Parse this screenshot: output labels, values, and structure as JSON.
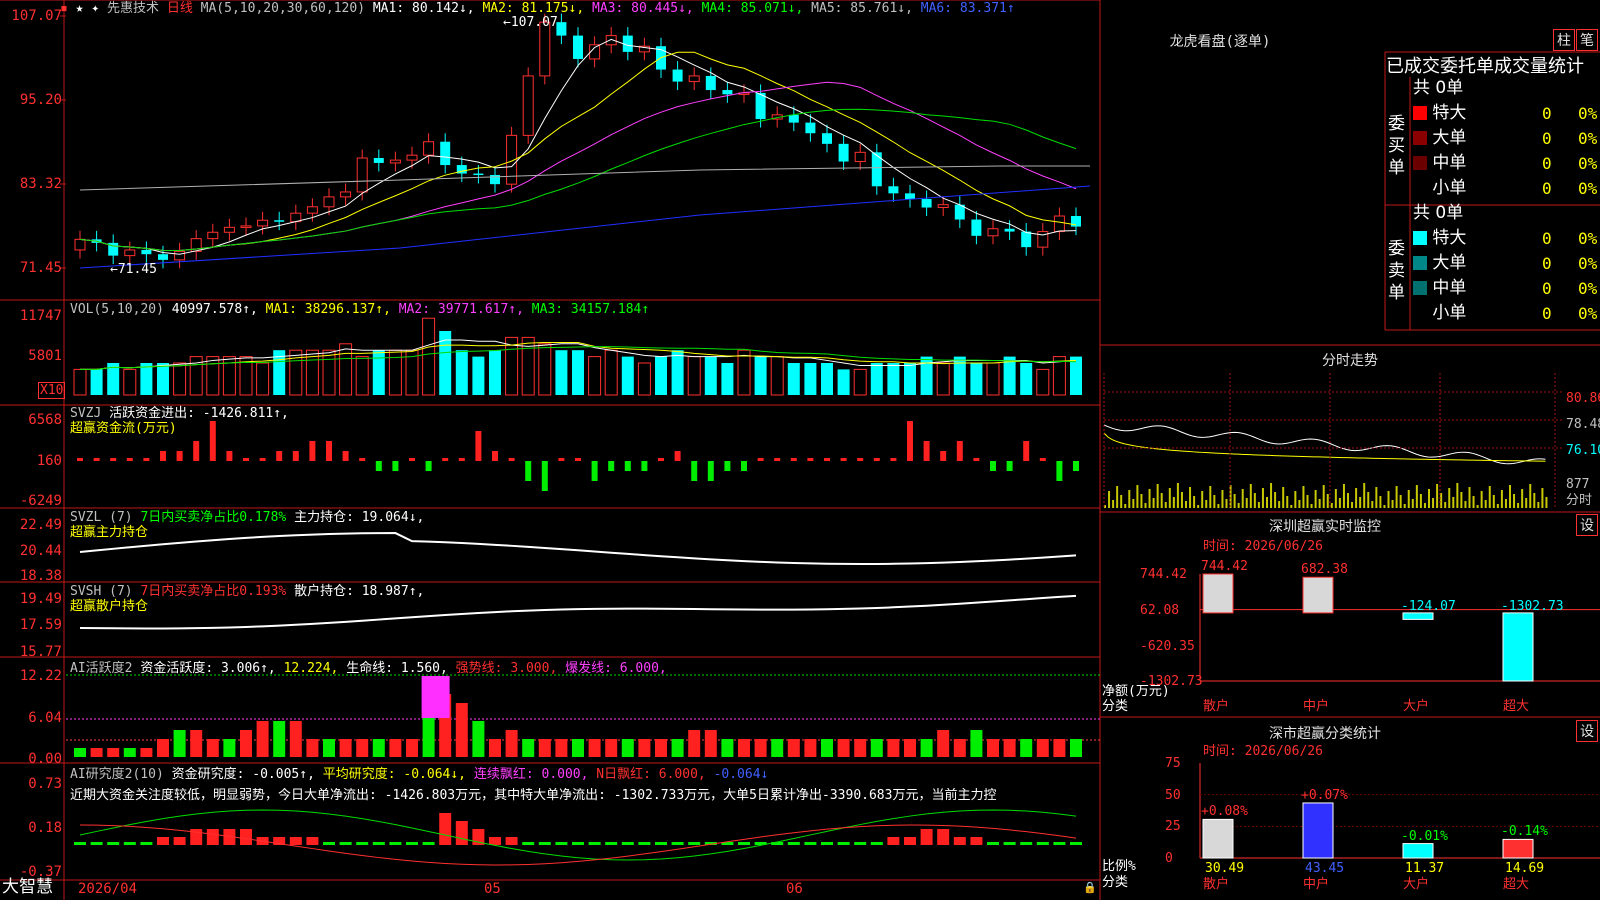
{
  "stock": {
    "name": "先惠技术",
    "period": "日线",
    "cross_icon": "✦"
  },
  "colors": {
    "up": "#ff3030",
    "down": "#00ffff",
    "ma1": "#ffffff",
    "ma2": "#ffff00",
    "ma3": "#ff40ff",
    "ma4": "#00dd00",
    "ma5": "#b0b0b0",
    "ma6": "#2030ff"
  },
  "main": {
    "ma_header": "MA(5,10,20,30,60,120)",
    "ma1": "MA1: 80.142↓,",
    "ma2": "MA2: 81.175↓,",
    "ma3": "MA3: 80.445↓,",
    "ma4": "MA4: 85.071↓,",
    "ma5": "MA5: 85.761↓,",
    "ma6": "MA6: 83.371↑",
    "axis": [
      "107.07",
      "95.20",
      "83.32",
      "71.45"
    ],
    "high_mark": "←107.07",
    "low_mark": "←71.45"
  },
  "vol": {
    "header": "VOL(5,10,20)",
    "value": "40997.578↑,",
    "ma1": "MA1: 38296.137↑,",
    "ma2": "MA2: 39771.617↑,",
    "ma3": "MA3: 34157.184↑",
    "axis": [
      "11747",
      "5801"
    ],
    "unit": "X10"
  },
  "svzj": {
    "header": "SVZJ",
    "title": "活跃资金进出: -1426.811↑,",
    "sub": "超赢资金流(万元)",
    "axis": [
      "6568",
      "160",
      "-6249"
    ]
  },
  "svzl": {
    "header": "SVZL (7)",
    "pct": "7日内买卖净占比0.178%",
    "hold": "主力持仓: 19.064↓,",
    "sub": "超赢主力持仓",
    "axis": [
      "22.49",
      "20.44",
      "18.38"
    ]
  },
  "svsh": {
    "header": "SVSH (7)",
    "pct": "7日内买卖净占比0.193%",
    "hold": "散户持仓: 18.987↑,",
    "sub": "超赢散户持仓",
    "axis": [
      "19.49",
      "17.59",
      "15.77"
    ]
  },
  "ai1": {
    "header": "AI活跃度2",
    "a": "资金活跃度: 3.006↑,",
    "b": "12.224,",
    "c": "生命线: 1.560,",
    "d": "强势线: 3.000,",
    "e": "爆发线: 6.000,",
    "axis": [
      "12.22",
      "6.04",
      "0.00"
    ]
  },
  "ai2": {
    "header": "AI研究度2(10)",
    "a": "资金研究度: -0.005↑,",
    "b": "平均研究度: -0.064↓,",
    "c": "连续飘红: 0.000,",
    "d": "N日飘红: 6.000,",
    "e": "-0.064↓",
    "text": "近期大资金关注度较低，明显弱势，今日大单净流出: -1426.803万元，其中特大单净流出: -1302.733万元，大单5日累计净出-3390.683万元，当前主力控",
    "axis": [
      "0.73",
      "0.18",
      "-0.37"
    ]
  },
  "bottom": {
    "brand": "大智慧",
    "dates": [
      "2026/04",
      "05",
      "06"
    ]
  },
  "lhb": {
    "title": "龙虎看盘(逐单)",
    "btn1": "柱",
    "btn2": "笔",
    "stat_title": "已成交委托单成交量统计",
    "buy_side": "委买单",
    "sell_side": "委卖单",
    "buy_total": "共 0单",
    "sell_total": "共 0单",
    "buy_rows": [
      {
        "name": "特大",
        "v": "0",
        "p": "0%",
        "c": "#ff0000"
      },
      {
        "name": "大单",
        "v": "0",
        "p": "0%",
        "c": "#8a0000"
      },
      {
        "name": "中单",
        "v": "0",
        "p": "0%",
        "c": "#6a0000"
      },
      {
        "name": "小单",
        "v": "0",
        "p": "0%",
        "c": ""
      }
    ],
    "sell_rows": [
      {
        "name": "特大",
        "v": "0",
        "p": "0%",
        "c": "#00ffff"
      },
      {
        "name": "大单",
        "v": "0",
        "p": "0%",
        "c": "#008888"
      },
      {
        "name": "中单",
        "v": "0",
        "p": "0%",
        "c": "#007070"
      },
      {
        "name": "小单",
        "v": "0",
        "p": "0%",
        "c": ""
      }
    ]
  },
  "intraday": {
    "title": "分时走势",
    "axis": [
      "80.86",
      "78.48",
      "76.10"
    ],
    "vol": "877",
    "label": "分时"
  },
  "monitor": {
    "title": "深圳超赢实时监控",
    "btn": "设",
    "date": "时间: 2026/06/26",
    "axis": [
      "744.42",
      "62.08",
      "-620.35",
      "-1302.73"
    ],
    "values": [
      {
        "cat": "散户",
        "v": 744.42,
        "label": "744.42"
      },
      {
        "cat": "中户",
        "v": 682.38,
        "label": "682.38"
      },
      {
        "cat": "大户",
        "v": -124.07,
        "label": "-124.07"
      },
      {
        "cat": "超大",
        "v": -1302.73,
        "label": "-1302.73"
      }
    ],
    "ylabel": "净额(万元)",
    "xlabel": "分类"
  },
  "classify": {
    "title": "深市超赢分类统计",
    "btn": "设",
    "date": "时间: 2026/06/26",
    "axis": [
      "75",
      "50",
      "25",
      "0"
    ],
    "values": [
      {
        "cat": "散户",
        "v": 30.49,
        "chg": "+0.08%"
      },
      {
        "cat": "中户",
        "v": 43.45,
        "chg": "+0.07%"
      },
      {
        "cat": "大户",
        "v": 11.37,
        "chg": "-0.01%"
      },
      {
        "cat": "超大",
        "v": 14.69,
        "chg": "-0.14%"
      }
    ],
    "ylabel": "比例%",
    "xlabel": "分类"
  }
}
